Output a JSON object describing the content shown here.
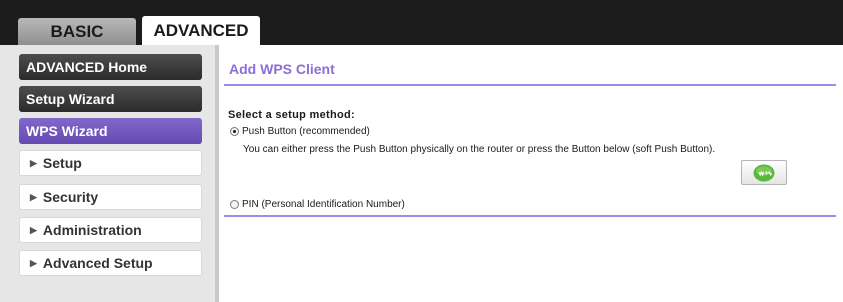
{
  "tabs": {
    "basic": "BASIC",
    "advanced": "ADVANCED"
  },
  "sidebar": {
    "items": [
      {
        "label": "ADVANCED Home"
      },
      {
        "label": "Setup Wizard"
      },
      {
        "label": "WPS Wizard"
      },
      {
        "label": "Setup"
      },
      {
        "label": "Security"
      },
      {
        "label": "Administration"
      },
      {
        "label": "Advanced Setup"
      }
    ],
    "expand_icon": "triangle-right-icon"
  },
  "main": {
    "title": "Add WPS Client",
    "method_label": "Select a setup method:",
    "push_button_option": "Push Button (recommended)",
    "push_button_desc": "You can either press the Push Button physically on the router or press the Button below (soft Push Button).",
    "wps_button_icon": "wps-icon",
    "pin_option": "PIN (Personal Identification Number)",
    "selected_method": "Push Button (recommended)"
  },
  "colors": {
    "accent_purple": "#8b6ed6",
    "rule_purple": "#a48ae6",
    "active_nav": "#6f54bd",
    "dark_nav": "#3a3a3a",
    "top_bar": "#1c1c1c",
    "wps_green": "#57b83a"
  }
}
